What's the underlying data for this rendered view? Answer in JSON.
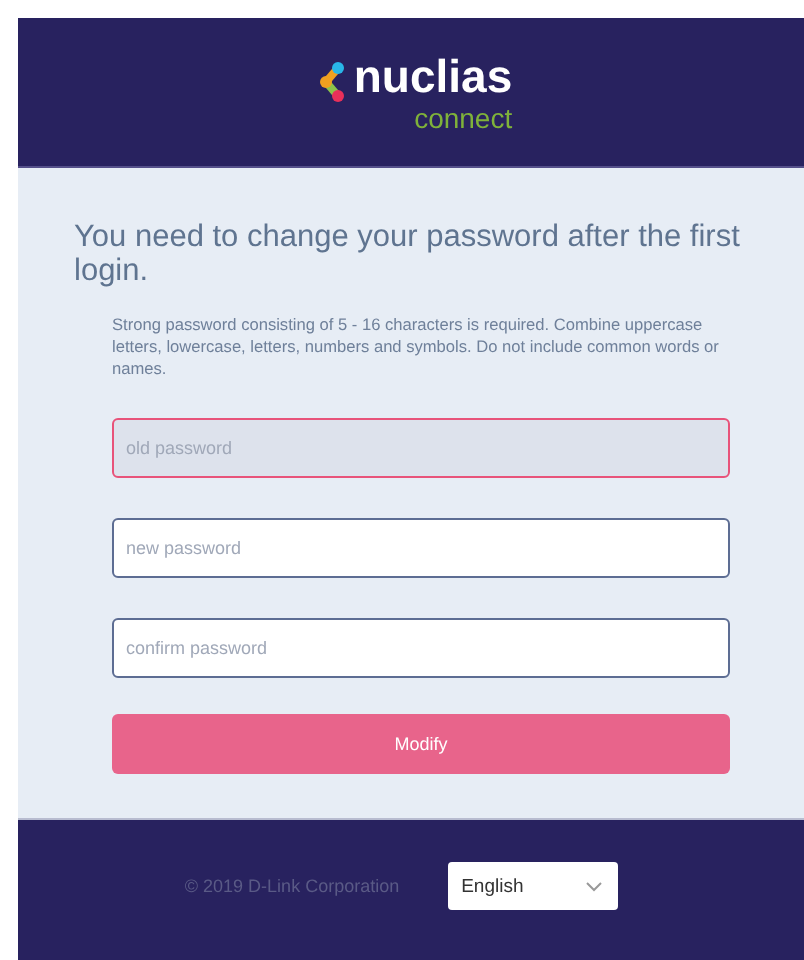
{
  "header": {
    "logo_word": "nuclias",
    "logo_subword": "connect"
  },
  "form": {
    "title": "You need to change your password after the first login.",
    "hint": "Strong password consisting of 5 - 16 characters is required. Combine uppercase letters, lowercase, letters, numbers and symbols. Do not include common words or names.",
    "fields": [
      {
        "placeholder": "old password",
        "focused": true
      },
      {
        "placeholder": "new password",
        "focused": false
      },
      {
        "placeholder": "confirm password",
        "focused": false
      }
    ],
    "submit": "Modify"
  },
  "footer": {
    "copyright": "© 2019 D-Link Corporation",
    "language": "English"
  }
}
